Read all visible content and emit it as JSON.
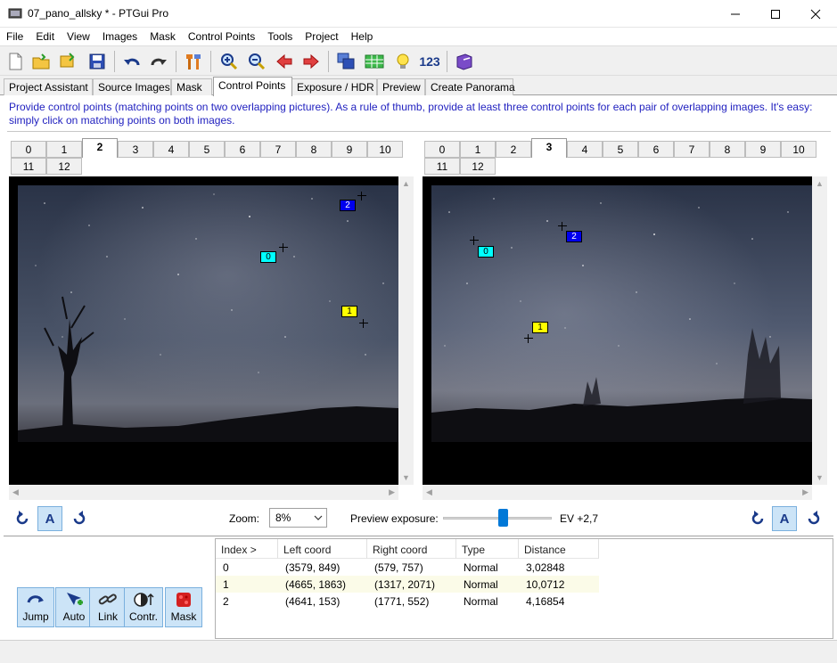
{
  "window": {
    "title": "07_pano_allsky * - PTGui Pro"
  },
  "menu": [
    "File",
    "Edit",
    "View",
    "Images",
    "Mask",
    "Control Points",
    "Tools",
    "Project",
    "Help"
  ],
  "toolbar": {
    "number_button": "123"
  },
  "main_tabs": [
    "Project Assistant",
    "Source Images",
    "Mask",
    "Control Points",
    "Exposure / HDR",
    "Preview",
    "Create Panorama"
  ],
  "active_main_tab": "Control Points",
  "instructions": "Provide control points (matching points on two overlapping pictures). As a rule of thumb, provide at least three control points for each pair of overlapping images. It's easy: simply click on matching points on both images.",
  "left_image_tabs": [
    "0",
    "1",
    "2",
    "3",
    "4",
    "5",
    "6",
    "7",
    "8",
    "9",
    "10",
    "11",
    "12"
  ],
  "left_active_tab": "2",
  "right_image_tabs": [
    "0",
    "1",
    "2",
    "3",
    "4",
    "5",
    "6",
    "7",
    "8",
    "9",
    "10",
    "11",
    "12"
  ],
  "right_active_tab": "3",
  "left_points": [
    {
      "label": "0",
      "color": "#00ffff"
    },
    {
      "label": "1",
      "color": "#ffff00"
    },
    {
      "label": "2",
      "color": "#0000ee"
    }
  ],
  "right_points": [
    {
      "label": "0",
      "color": "#00ffff"
    },
    {
      "label": "1",
      "color": "#ffff00"
    },
    {
      "label": "2",
      "color": "#0000ee"
    }
  ],
  "controls": {
    "auto_label": "A",
    "zoom_label": "Zoom:",
    "zoom_value": "8%",
    "exposure_label": "Preview exposure:",
    "exposure_value": "EV +2,7",
    "exposure_fraction": 0.55
  },
  "tools": [
    {
      "label": "Jump",
      "icon": "jump-icon"
    },
    {
      "label": "Auto",
      "icon": "auto-icon"
    },
    {
      "label": "Link",
      "icon": "link-icon"
    },
    {
      "label": "Contr.",
      "icon": "contrast-icon"
    },
    {
      "label": "Mask",
      "icon": "mask-icon"
    }
  ],
  "table": {
    "headers": [
      "Index >",
      "Left coord",
      "Right coord",
      "Type",
      "Distance"
    ],
    "rows": [
      {
        "index": "0",
        "left": "(3579, 849)",
        "right": "(579, 757)",
        "type": "Normal",
        "distance": "3,02848"
      },
      {
        "index": "1",
        "left": "(4665, 1863)",
        "right": "(1317, 2071)",
        "type": "Normal",
        "distance": "10,0712"
      },
      {
        "index": "2",
        "left": "(4641, 153)",
        "right": "(1771, 552)",
        "type": "Normal",
        "distance": "4,16854"
      }
    ]
  }
}
